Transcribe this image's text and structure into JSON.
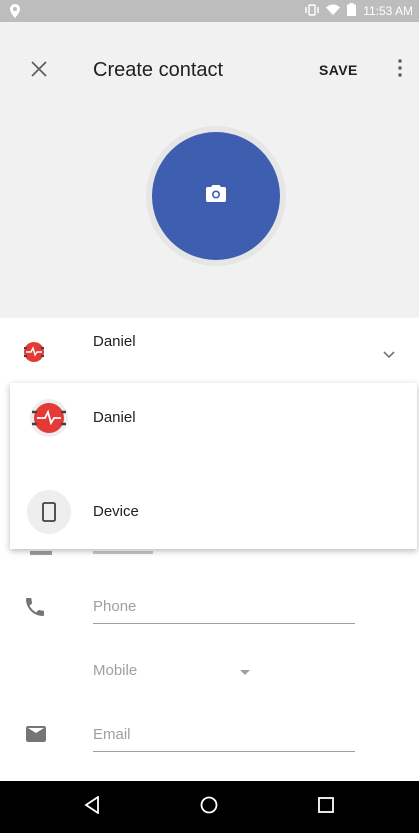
{
  "status_bar": {
    "time": "11:53 AM"
  },
  "app_bar": {
    "title": "Create contact",
    "save_label": "SAVE"
  },
  "account": {
    "name": "Daniel"
  },
  "account_menu": {
    "items": [
      {
        "label": "Daniel",
        "icon": "account-avatar-icon"
      },
      {
        "label": "Device",
        "icon": "phone-device-icon"
      }
    ]
  },
  "form": {
    "phone_placeholder": "Phone",
    "phone_type": "Mobile",
    "email_placeholder": "Email"
  },
  "colors": {
    "photo_bg": "#3e5eb0",
    "app_bar_bg": "#f1f1f1",
    "avatar_red": "#e53935",
    "nav_bar": "#000000"
  }
}
